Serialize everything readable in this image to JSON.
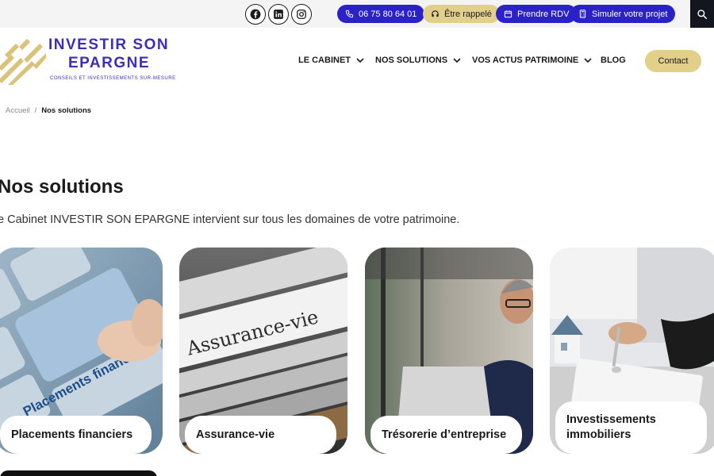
{
  "topbar": {
    "social": [
      "facebook-icon",
      "linkedin-icon",
      "instagram-icon"
    ],
    "phone": "06 75 80 64 01",
    "callback": "Être rappelé",
    "appointment": "Prendre RDV",
    "simulate": "Simuler votre projet"
  },
  "logo": {
    "line1": "INVESTIR SON",
    "line2": "EPARGNE",
    "tagline": "CONSEILS ET INVESTISSEMENTS SUR-MESURE"
  },
  "nav": {
    "items": [
      {
        "label": "LE CABINET",
        "dropdown": true
      },
      {
        "label": "NOS SOLUTIONS",
        "dropdown": true
      },
      {
        "label": "VOS ACTUS PATRIMOINE",
        "dropdown": true
      },
      {
        "label": "BLOG",
        "dropdown": false
      }
    ],
    "contact": "Contact"
  },
  "breadcrumb": {
    "home": "Accueil",
    "separator": "/",
    "current": "Nos solutions"
  },
  "page": {
    "title": "Nos solutions",
    "intro": "e Cabinet INVESTIR SON EPARGNE intervient sur tous les domaines de votre patrimoine."
  },
  "cards": [
    {
      "label": "Placements financiers",
      "image_text": "Placements financiers"
    },
    {
      "label": "Assurance-vie",
      "image_text": "Assurance-vie"
    },
    {
      "label": "Trésorerie d’entreprise"
    },
    {
      "label": "Investissements immobiliers"
    }
  ],
  "colors": {
    "brand_blue": "#2a22c6",
    "logo_blue": "#3b2fb6",
    "gold": "#e2cf8a",
    "dark": "#14161f"
  }
}
